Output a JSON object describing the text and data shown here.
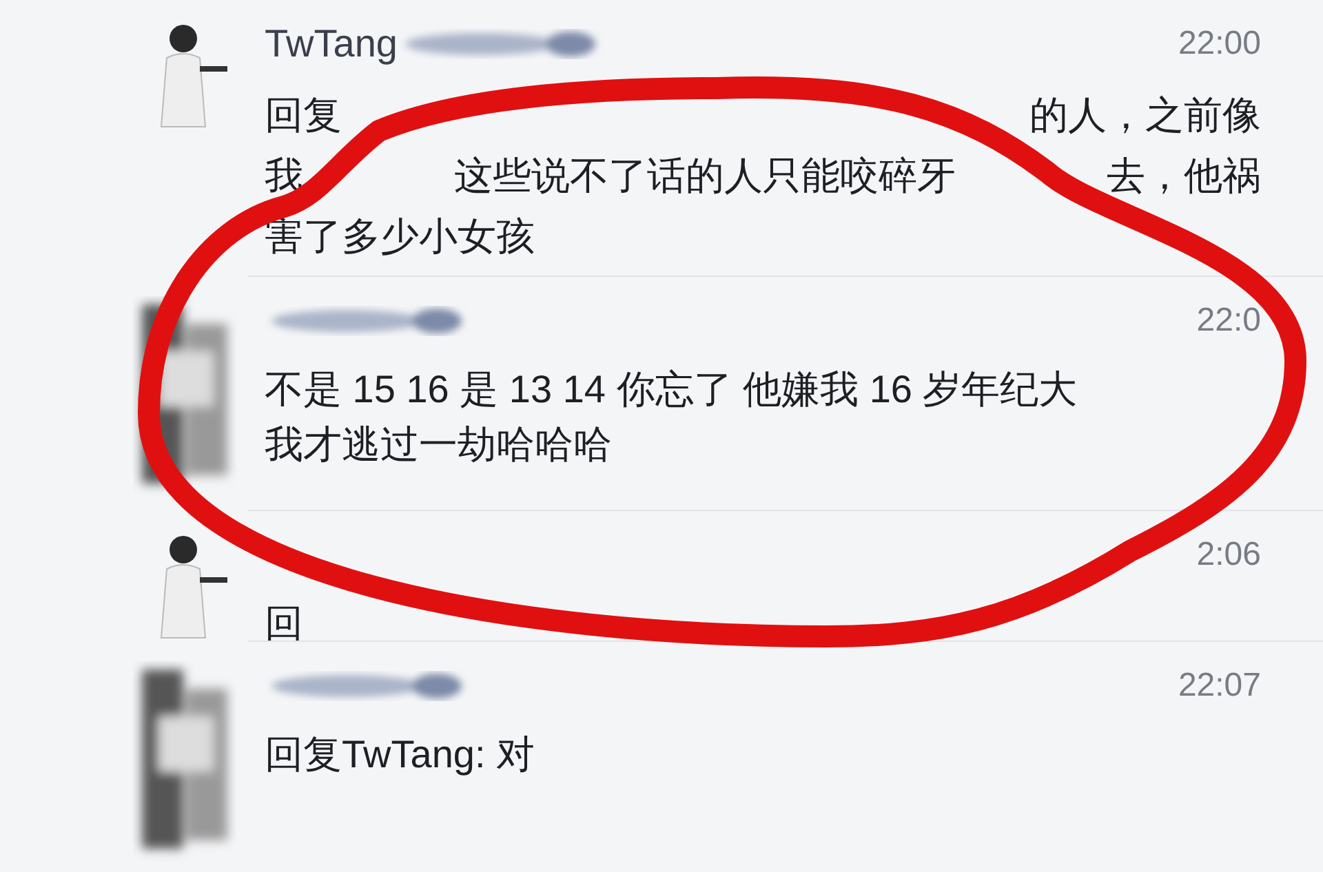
{
  "annotation": {
    "kind": "ellipse",
    "color": "#e01010"
  },
  "messages": [
    {
      "kind": "figure",
      "name": "TwTang",
      "name_redacted": true,
      "time": "22:00",
      "lines": [
        [
          "回复",
          "的人，之前像"
        ],
        [
          "我",
          "这些说不了话的人只能咬碎牙",
          "去，他祸"
        ],
        [
          "害了多少小女孩"
        ]
      ]
    },
    {
      "kind": "blurred",
      "name_redacted": true,
      "time": "22:0",
      "lines": [
        [
          "不是 15 16 是 13 14 你忘了 他嫌我 16 岁年纪大"
        ],
        [
          "我才逃过一劫哈哈哈"
        ]
      ]
    },
    {
      "kind": "figure",
      "name_redacted": false,
      "time": "2:06",
      "lines": [
        [
          "回"
        ]
      ]
    },
    {
      "kind": "blurred",
      "name_redacted": true,
      "time": "22:07",
      "lines": [
        [
          "回复TwTang: 对"
        ]
      ]
    }
  ]
}
